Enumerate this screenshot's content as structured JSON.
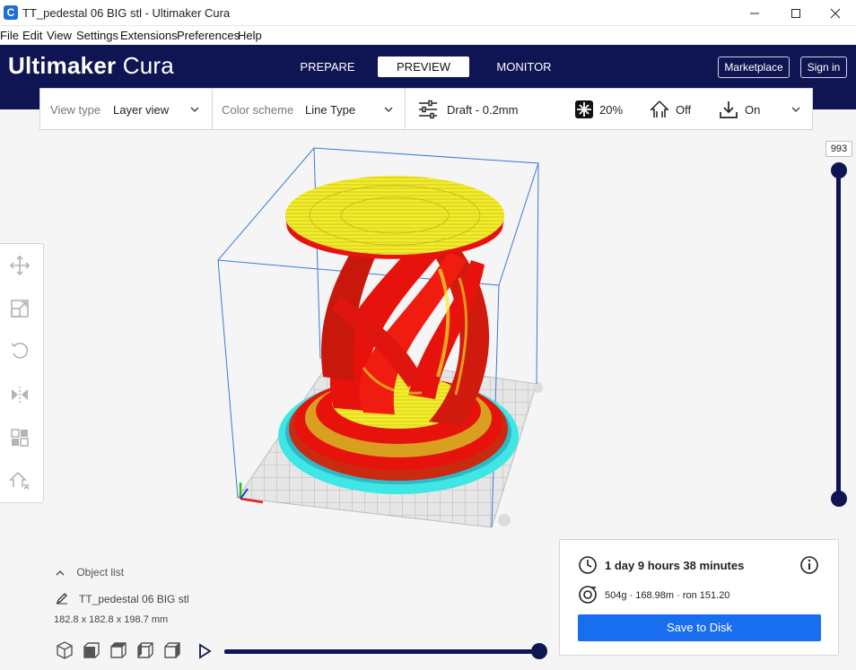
{
  "window": {
    "app_icon_letter": "C",
    "title": "TT_pedestal 06 BIG stl - Ultimaker Cura"
  },
  "menu": [
    "File",
    "Edit",
    "View",
    "Settings",
    "Extensions",
    "Preferences",
    "Help"
  ],
  "header": {
    "logo_bold": "Ultimaker",
    "logo_light": "Cura",
    "tabs": [
      {
        "label": "PREPARE",
        "active": false
      },
      {
        "label": "PREVIEW",
        "active": true
      },
      {
        "label": "MONITOR",
        "active": false
      }
    ],
    "marketplace_label": "Marketplace",
    "signin_label": "Sign in",
    "background_color": "#0f1552"
  },
  "toolbar": {
    "view_type_label": "View type",
    "view_type_value": "Layer view",
    "color_scheme_label": "Color scheme",
    "color_scheme_value": "Line Type",
    "profile": "Draft - 0.2mm",
    "infill": "20%",
    "support": "Off",
    "adhesion": "On"
  },
  "layer_slider": {
    "value": "993"
  },
  "object_list": {
    "toggle_label": "Object list",
    "object_name": "TT_pedestal 06 BIG stl",
    "dimensions": "182.8 x 182.8 x 198.7 mm"
  },
  "print_info": {
    "time": "1 day 9 hours 38 minutes",
    "material": "504g · 168.98m · ron 151.20",
    "save_label": "Save to Disk",
    "button_color": "#196ef0"
  },
  "model_colors": {
    "wall": "#e8120c",
    "top_skin": "#f2ee2a",
    "skirt": "#3ee6e6"
  }
}
